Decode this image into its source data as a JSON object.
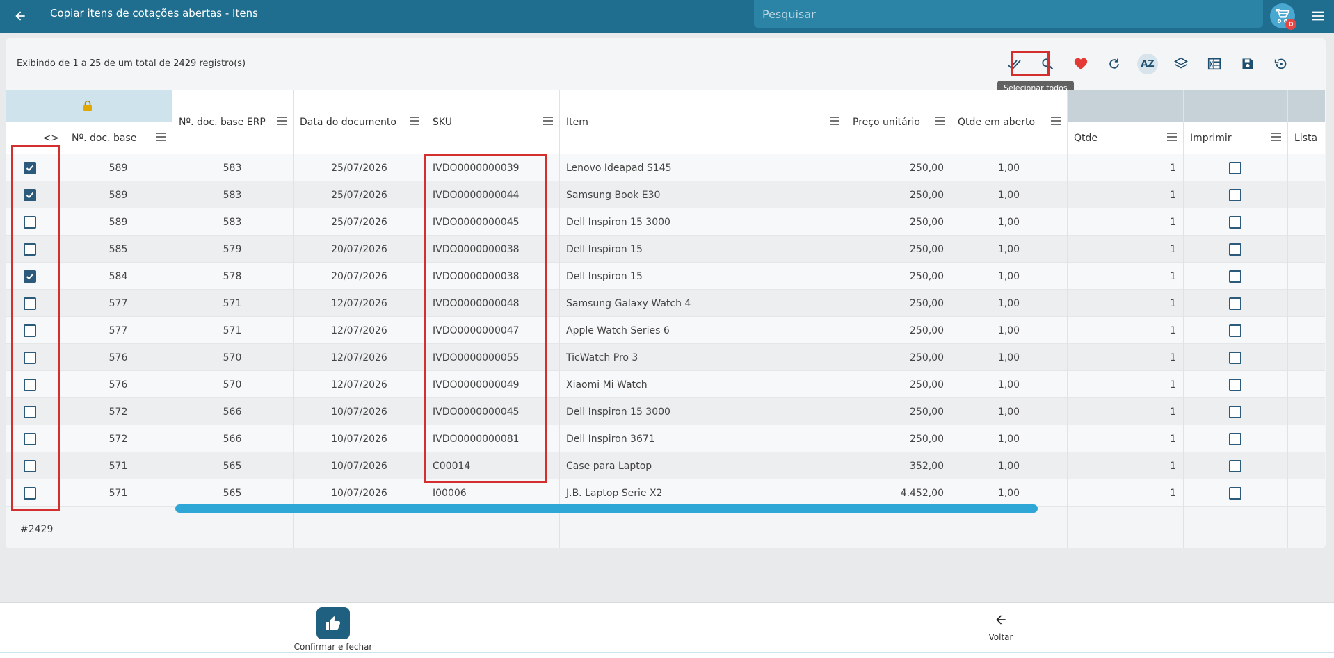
{
  "header": {
    "title": "Copiar itens de cotações abertas - Itens",
    "search_placeholder": "Pesquisar",
    "cart_count": "0"
  },
  "records_info": "Exibindo de 1 a 25 de um total de 2429 registro(s)",
  "toolbar": {
    "tooltip": "Selecionar todos",
    "icons": [
      "select-all-icon",
      "search-icon",
      "heart-icon",
      "refresh-icon",
      "sort-az-icon",
      "layers-icon",
      "excel-icon",
      "save-icon",
      "restore-icon"
    ]
  },
  "columns": {
    "toggle": "<>",
    "doc_base": "Nº. doc. base",
    "doc_base_erp": "Nº. doc. base ERP",
    "date": "Data do documento",
    "sku": "SKU",
    "item": "Item",
    "price": "Preço unitário",
    "open_qty": "Qtde em aberto",
    "qty": "Qtde",
    "print": "Imprimir",
    "list": "Lista"
  },
  "rows": [
    {
      "checked": true,
      "doc": "589",
      "erp": "583",
      "date": "25/07/2026",
      "sku": "IVDO0000000039",
      "item": "Lenovo Ideapad S145",
      "price": "250,00",
      "open": "1,00",
      "qty": "1"
    },
    {
      "checked": true,
      "doc": "589",
      "erp": "583",
      "date": "25/07/2026",
      "sku": "IVDO0000000044",
      "item": "Samsung Book E30",
      "price": "250,00",
      "open": "1,00",
      "qty": "1"
    },
    {
      "checked": false,
      "doc": "589",
      "erp": "583",
      "date": "25/07/2026",
      "sku": "IVDO0000000045",
      "item": "Dell Inspiron 15 3000",
      "price": "250,00",
      "open": "1,00",
      "qty": "1"
    },
    {
      "checked": false,
      "doc": "585",
      "erp": "579",
      "date": "20/07/2026",
      "sku": "IVDO0000000038",
      "item": "Dell Inspiron 15",
      "price": "250,00",
      "open": "1,00",
      "qty": "1"
    },
    {
      "checked": true,
      "doc": "584",
      "erp": "578",
      "date": "20/07/2026",
      "sku": "IVDO0000000038",
      "item": "Dell Inspiron 15",
      "price": "250,00",
      "open": "1,00",
      "qty": "1"
    },
    {
      "checked": false,
      "doc": "577",
      "erp": "571",
      "date": "12/07/2026",
      "sku": "IVDO0000000048",
      "item": "Samsung Galaxy Watch 4",
      "price": "250,00",
      "open": "1,00",
      "qty": "1"
    },
    {
      "checked": false,
      "doc": "577",
      "erp": "571",
      "date": "12/07/2026",
      "sku": "IVDO0000000047",
      "item": "Apple Watch Series 6",
      "price": "250,00",
      "open": "1,00",
      "qty": "1"
    },
    {
      "checked": false,
      "doc": "576",
      "erp": "570",
      "date": "12/07/2026",
      "sku": "IVDO0000000055",
      "item": "TicWatch Pro 3",
      "price": "250,00",
      "open": "1,00",
      "qty": "1"
    },
    {
      "checked": false,
      "doc": "576",
      "erp": "570",
      "date": "12/07/2026",
      "sku": "IVDO0000000049",
      "item": "Xiaomi Mi Watch",
      "price": "250,00",
      "open": "1,00",
      "qty": "1"
    },
    {
      "checked": false,
      "doc": "572",
      "erp": "566",
      "date": "10/07/2026",
      "sku": "IVDO0000000045",
      "item": "Dell Inspiron 15 3000",
      "price": "250,00",
      "open": "1,00",
      "qty": "1"
    },
    {
      "checked": false,
      "doc": "572",
      "erp": "566",
      "date": "10/07/2026",
      "sku": "IVDO0000000081",
      "item": "Dell Inspiron 3671",
      "price": "250,00",
      "open": "1,00",
      "qty": "1"
    },
    {
      "checked": false,
      "doc": "571",
      "erp": "565",
      "date": "10/07/2026",
      "sku": "C00014",
      "item": "Case para Laptop",
      "price": "352,00",
      "open": "1,00",
      "qty": "1"
    },
    {
      "checked": false,
      "doc": "571",
      "erp": "565",
      "date": "10/07/2026",
      "sku": "I00006",
      "item": "J.B. Laptop Serie X2",
      "price": "4.452,00",
      "open": "1,00",
      "qty": "1"
    }
  ],
  "footer_count": "#2429",
  "bottom": {
    "confirm_label": "Confirmar e fechar",
    "back_label": "Voltar"
  },
  "colors": {
    "header_bg": "#1f6e90",
    "accent": "#2b5a7a",
    "highlight": "#d32f2f",
    "scrollbar": "#2ea6d6"
  }
}
